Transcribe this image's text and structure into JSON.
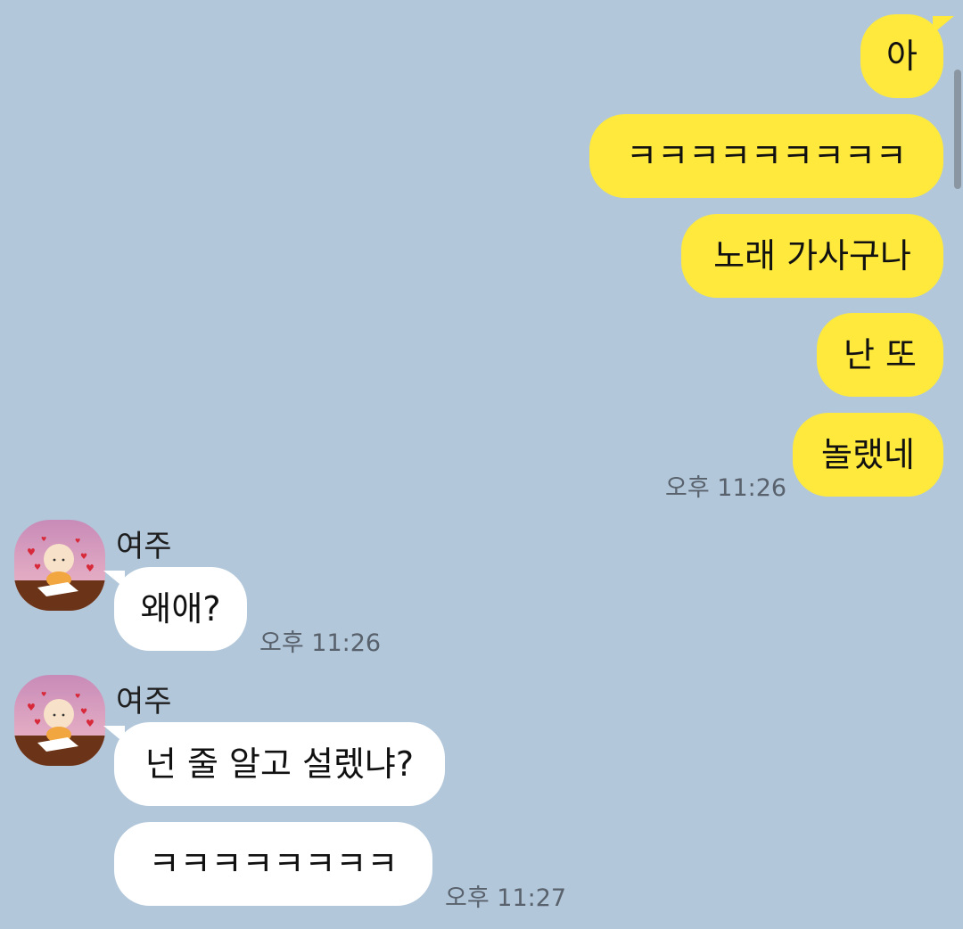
{
  "chat": {
    "sent": [
      {
        "text": "아"
      },
      {
        "text": "ㅋㅋㅋㅋㅋㅋㅋㅋㅋ"
      },
      {
        "text": "노래 가사구나"
      },
      {
        "text": "난 또"
      },
      {
        "text": "놀랬네",
        "time": "오후 11:26"
      }
    ],
    "received_1": {
      "sender": "여주",
      "avatar_icon": "baby-drawing-avatar-icon",
      "messages": [
        {
          "text": "왜애?",
          "time": "오후 11:26"
        }
      ]
    },
    "received_2": {
      "sender": "여주",
      "avatar_icon": "baby-drawing-avatar-icon",
      "messages": [
        {
          "text": "넌 줄 알고 설렜냐?"
        },
        {
          "text": "ㅋㅋㅋㅋㅋㅋㅋㅋ",
          "time": "오후 11:27"
        }
      ]
    }
  },
  "colors": {
    "background": "#b2c7da",
    "sent_bubble": "#fee93c",
    "received_bubble": "#ffffff"
  }
}
